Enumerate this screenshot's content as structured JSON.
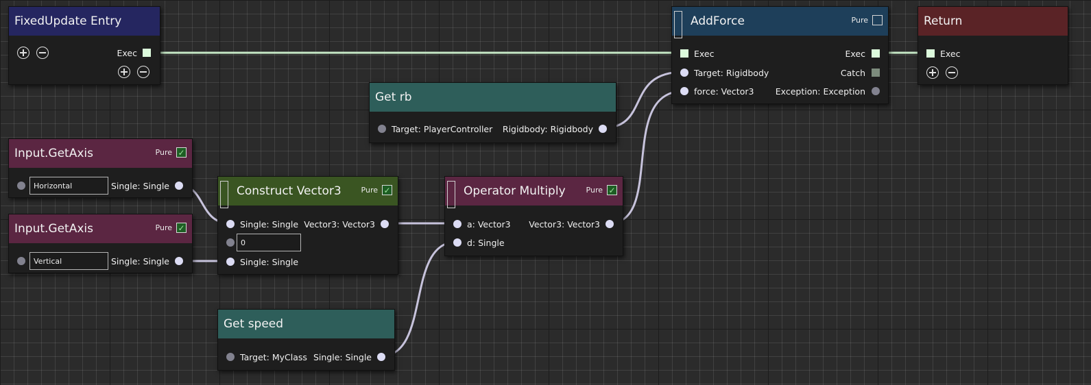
{
  "colors": {
    "entry_header": "#252660",
    "addforce_header": "#1e3f5a",
    "return_header": "#5a2326",
    "getter_header": "#2e5e5a",
    "axis_header": "#5b2642",
    "construct_header": "#3a5522",
    "multiply_header": "#5b2642",
    "wire_data": "#c7c3dc",
    "wire_exec": "#c6e8c6"
  },
  "nodes": {
    "fixed_update": {
      "title": "FixedUpdate Entry",
      "exec_label": "Exec"
    },
    "add_force": {
      "title": "AddForce",
      "pure_label": "Pure",
      "pure_checked": false,
      "exec_in": "Exec",
      "exec_out": "Exec",
      "target": "Target: Rigidbody",
      "catch": "Catch",
      "force": "force: Vector3",
      "exception": "Exception: Exception"
    },
    "return": {
      "title": "Return",
      "exec_label": "Exec"
    },
    "get_rb": {
      "title": "Get rb",
      "target": "Target: PlayerController",
      "output": "Rigidbody: Rigidbody"
    },
    "get_axis_1": {
      "title": "Input.GetAxis",
      "pure_label": "Pure",
      "pure_checked": true,
      "value": "Horizontal",
      "output": "Single: Single"
    },
    "get_axis_2": {
      "title": "Input.GetAxis",
      "pure_label": "Pure",
      "pure_checked": true,
      "value": "Vertical",
      "output": "Single: Single"
    },
    "construct_vector3": {
      "title": "Construct Vector3",
      "pure_label": "Pure",
      "pure_checked": true,
      "in_x": "Single: Single",
      "in_y_value": "0",
      "in_z": "Single: Single",
      "output": "Vector3: Vector3"
    },
    "operator_multiply": {
      "title": "Operator Multiply",
      "pure_label": "Pure",
      "pure_checked": true,
      "in_a": "a: Vector3",
      "in_d": "d: Single",
      "output": "Vector3: Vector3"
    },
    "get_speed": {
      "title": "Get speed",
      "target": "Target: MyClass",
      "output": "Single: Single"
    }
  }
}
